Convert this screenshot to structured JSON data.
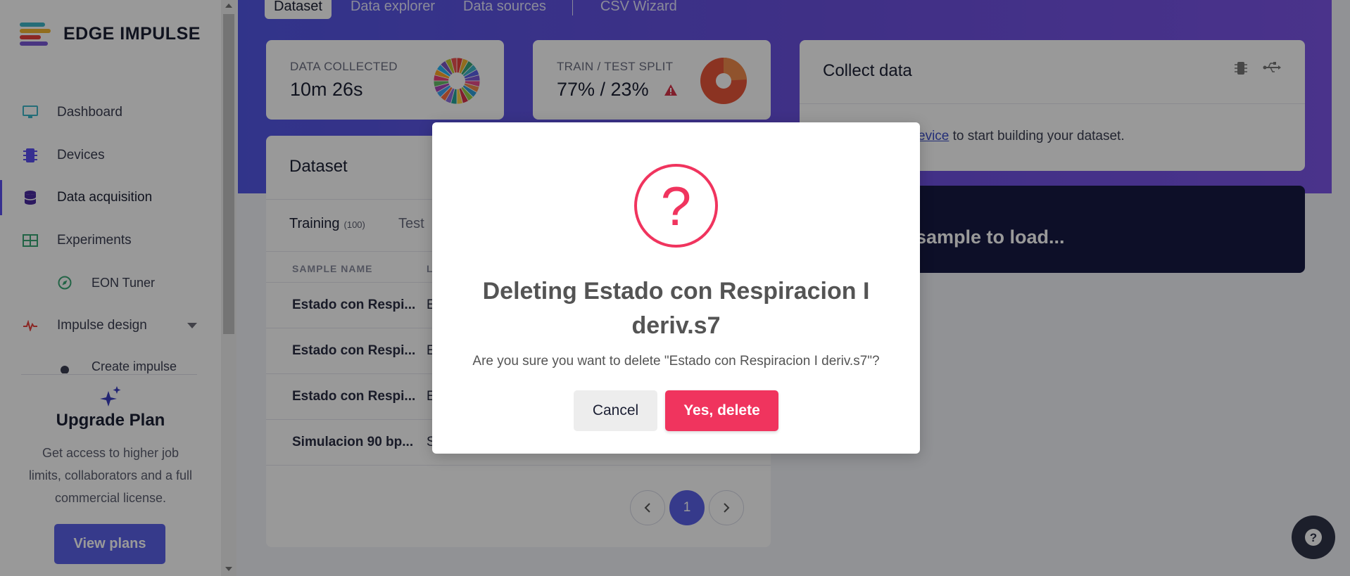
{
  "brand": {
    "name": "EDGE IMPULSE"
  },
  "sidebar": {
    "items": [
      {
        "label": "Dashboard",
        "icon": "monitor-icon"
      },
      {
        "label": "Devices",
        "icon": "chip-icon"
      },
      {
        "label": "Data acquisition",
        "icon": "database-icon"
      },
      {
        "label": "Experiments",
        "icon": "table-icon"
      },
      {
        "label": "EON Tuner",
        "icon": "compass-icon"
      },
      {
        "label": "Impulse design",
        "icon": "pulse-icon"
      },
      {
        "label": "Create impulse",
        "icon": "dot-icon"
      }
    ],
    "upgrade": {
      "title": "Upgrade Plan",
      "text": "Get access to higher job limits, collaborators and a full commercial license.",
      "button": "View plans"
    }
  },
  "top_tabs": [
    "Dataset",
    "Data explorer",
    "Data sources",
    "CSV Wizard"
  ],
  "stats": {
    "collected_label": "DATA COLLECTED",
    "collected_value": "10m 26s",
    "split_label": "TRAIN / TEST SPLIT",
    "split_value": "77% / 23%"
  },
  "collect": {
    "title": "Collect data",
    "text_link": "evice",
    "text_rest": " to start building your dataset."
  },
  "sample_loader": {
    "text": "sample to load..."
  },
  "dataset": {
    "title": "Dataset",
    "tab_training": "Training",
    "tab_training_count": "(100)",
    "tab_test": "Test",
    "col_sample_name": "SAMPLE NAME",
    "col_label": "L",
    "rows": [
      {
        "name": "Estado con Respi...",
        "label": "E"
      },
      {
        "name": "Estado con Respi...",
        "label": "E"
      },
      {
        "name": "Estado con Respi...",
        "label": "E"
      },
      {
        "name": "Simulacion 90 bp...",
        "label": "S"
      }
    ],
    "pagination": {
      "current": "1"
    }
  },
  "modal": {
    "icon_glyph": "?",
    "title": "Deleting Estado con Respiracion I deriv.s7",
    "message": "Are you sure you want to delete \"Estado con Respiracion I deriv.s7\"?",
    "cancel": "Cancel",
    "confirm": "Yes, delete"
  },
  "colors": {
    "accent": "#5a62e8",
    "danger": "#f0345e",
    "dark": "#161a44"
  }
}
